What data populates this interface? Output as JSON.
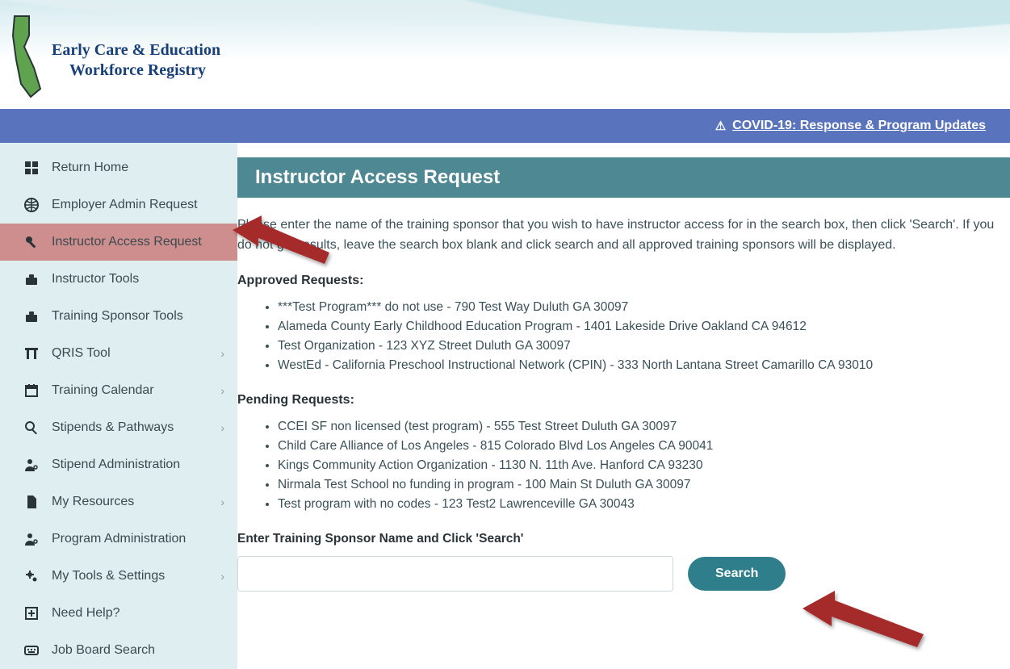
{
  "brand": {
    "line1": "Early Care & Education",
    "line2": "Workforce Registry"
  },
  "covid_bar": {
    "icon_name": "warning-icon",
    "label": "COVID-19: Response & Program Updates"
  },
  "sidebar": {
    "items": [
      {
        "label": "Return Home",
        "icon": "grid",
        "chevron": false,
        "active": false
      },
      {
        "label": "Employer Admin Request",
        "icon": "globe",
        "chevron": false,
        "active": false
      },
      {
        "label": "Instructor Access Request",
        "icon": "key",
        "chevron": false,
        "active": true
      },
      {
        "label": "Instructor Tools",
        "icon": "toolbox",
        "chevron": false,
        "active": false
      },
      {
        "label": "Training Sponsor Tools",
        "icon": "toolbox",
        "chevron": false,
        "active": false
      },
      {
        "label": "QRIS Tool",
        "icon": "arch",
        "chevron": true,
        "active": false
      },
      {
        "label": "Training Calendar",
        "icon": "calendar",
        "chevron": true,
        "active": false
      },
      {
        "label": "Stipends & Pathways",
        "icon": "search",
        "chevron": true,
        "active": false
      },
      {
        "label": "Stipend Administration",
        "icon": "user-cog",
        "chevron": false,
        "active": false
      },
      {
        "label": "My Resources",
        "icon": "file",
        "chevron": true,
        "active": false
      },
      {
        "label": "Program Administration",
        "icon": "user-cog",
        "chevron": false,
        "active": false
      },
      {
        "label": "My Tools & Settings",
        "icon": "cogs",
        "chevron": true,
        "active": false
      },
      {
        "label": "Need Help?",
        "icon": "plus-box",
        "chevron": false,
        "active": false
      },
      {
        "label": "Job Board Search",
        "icon": "keyboard",
        "chevron": false,
        "active": false
      }
    ]
  },
  "main": {
    "title": "Instructor Access Request",
    "intro": "Please enter the name of the training sponsor that you wish to have instructor access for in the search box, then click 'Search'. If you do not get results, leave the search box blank and click search and all approved training sponsors will be displayed.",
    "approved_label": "Approved Requests:",
    "approved": [
      "***Test Program*** do not use - 790 Test Way Duluth GA 30097",
      "Alameda County Early Childhood Education Program - 1401 Lakeside Drive Oakland CA 94612",
      "Test Organization - 123 XYZ Street Duluth GA 30097",
      "WestEd - California Preschool Instructional Network (CPIN) - 333 North Lantana Street Camarillo CA 93010"
    ],
    "pending_label": "Pending Requests:",
    "pending": [
      "CCEI SF non licensed (test program) - 555 Test Street Duluth GA 30097",
      "Child Care Alliance of Los Angeles - 815 Colorado Blvd Los Angeles CA 90041",
      "Kings Community Action Organization - 1130 N. 11th Ave. Hanford CA 93230",
      "Nirmala Test School no funding in program - 100 Main St Duluth GA 30097",
      "Test program with no codes - 123 Test2 Lawrenceville GA 30043"
    ],
    "search_label": "Enter Training Sponsor Name and Click 'Search'",
    "search_value": "",
    "search_button": "Search"
  },
  "colors": {
    "brand_blue": "#18407a",
    "bar_blue": "#5a73bd",
    "teal": "#4d8893",
    "teal_btn": "#2e7e8c",
    "sidebar_bg": "#dfeff1",
    "active_row": "#ce8e8e",
    "arrow": "#a52c2c"
  }
}
